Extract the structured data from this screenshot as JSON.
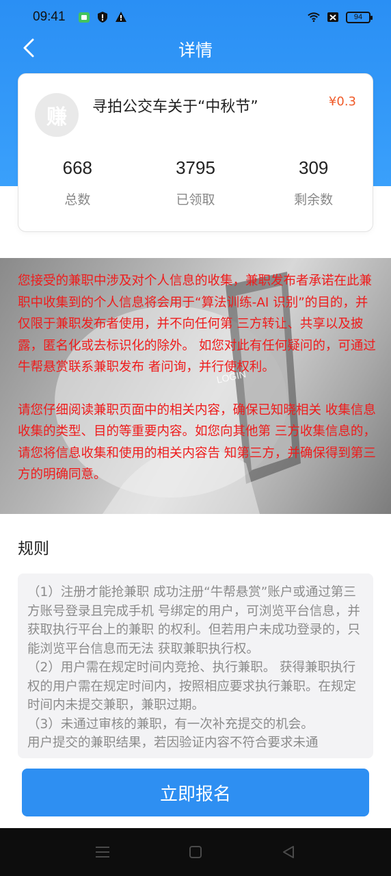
{
  "status_bar": {
    "time": "09:41",
    "battery": "94",
    "left_icons": [
      "app-notification-icon",
      "shield-icon",
      "warning-icon"
    ],
    "right_icons": [
      "wifi-icon",
      "sim-off-icon",
      "battery-icon"
    ]
  },
  "nav": {
    "title": "详情",
    "back_icon": "back-arrow-icon"
  },
  "task": {
    "avatar_text": "赚",
    "title": "寻拍公交车关于“中秋节”",
    "reward": "¥0.3",
    "stats": [
      {
        "value": "668",
        "label": "总数"
      },
      {
        "value": "3795",
        "label": "已领取"
      },
      {
        "value": "309",
        "label": "剩余数"
      }
    ]
  },
  "notice": {
    "paragraph_1": "您接受的兼职中涉及对个人信息的收集，兼职发布者承诺在此兼职中收集到的个人信息将会用于“算法训练-AI 识别”的目的，并仅限于兼职发布者使用，并不向任何第 三方转让、共享以及披露，匿名化或去标识化的除外。 如您对此有任何疑问的，可通过牛帮悬赏联系兼职发布 者问询，并行使权利。",
    "paragraph_2": "请您仔细阅读兼职页面中的相关内容，确保已知晓相关 收集信息收集的类型、目的等重要内容。如您向其他第 三方收集信息的，请您将信息收集和使用的相关内容告 知第三方，并确保得到第三方的明确同意。",
    "background_text": "LOGIN"
  },
  "rules": {
    "heading": "规则",
    "items": [
      "（1）注册才能抢兼职 成功注册“牛帮悬赏”账户或通过第三方账号登录且完成手机 号绑定的用户，可浏览平台信息，并获取执行平台上的兼职 的权利。但若用户未成功登录的，只能浏览平台信息而无法 获取兼职执行权。",
      "（2）用户需在规定时间内竞抢、执行兼职。 获得兼职执行权的用户需在规定时间内，按照相应要求执行兼职。在规定时间内未提交兼职，兼职过期。",
      "（3）未通过审核的兼职，有一次补充提交的机会。",
      "用户提交的兼职结果，若因验证内容不符合要求未通"
    ]
  },
  "action": {
    "signup_label": "立即报名"
  },
  "system_nav": {
    "icons": [
      "menu-icon",
      "home-icon",
      "back-triangle-icon"
    ]
  },
  "colors": {
    "header_blue": "#2a8ff4",
    "notice_red": "#ee1c1c",
    "reward_orange": "#f05a28",
    "button_blue": "#2e8ff2"
  }
}
